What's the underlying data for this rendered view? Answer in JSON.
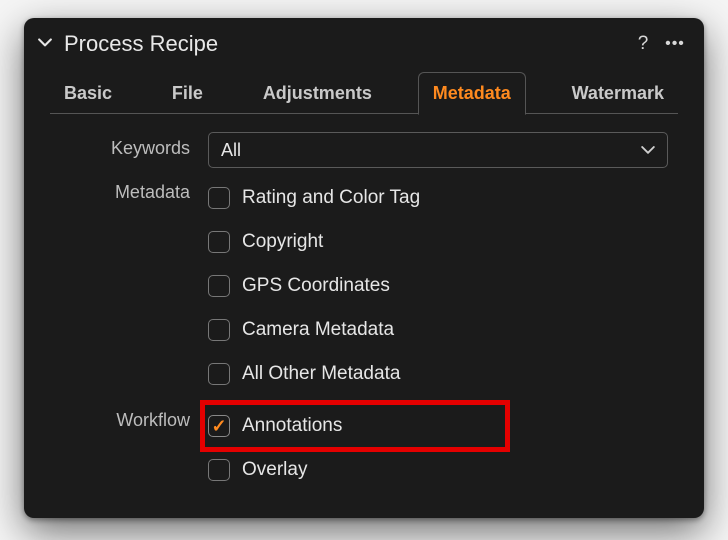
{
  "panel": {
    "title": "Process Recipe"
  },
  "tabs": [
    {
      "label": "Basic",
      "active": false
    },
    {
      "label": "File",
      "active": false
    },
    {
      "label": "Adjustments",
      "active": false
    },
    {
      "label": "Metadata",
      "active": true
    },
    {
      "label": "Watermark",
      "active": false
    }
  ],
  "keywords": {
    "label": "Keywords",
    "value": "All"
  },
  "metadata": {
    "label": "Metadata",
    "options": [
      {
        "label": "Rating and Color Tag",
        "checked": false
      },
      {
        "label": "Copyright",
        "checked": false
      },
      {
        "label": "GPS Coordinates",
        "checked": false
      },
      {
        "label": "Camera Metadata",
        "checked": false
      },
      {
        "label": "All Other Metadata",
        "checked": false
      }
    ]
  },
  "workflow": {
    "label": "Workflow",
    "options": [
      {
        "label": "Annotations",
        "checked": true,
        "highlighted": true
      },
      {
        "label": "Overlay",
        "checked": false
      }
    ]
  },
  "colors": {
    "accent": "#ff8a1f",
    "highlight": "#e40000"
  }
}
